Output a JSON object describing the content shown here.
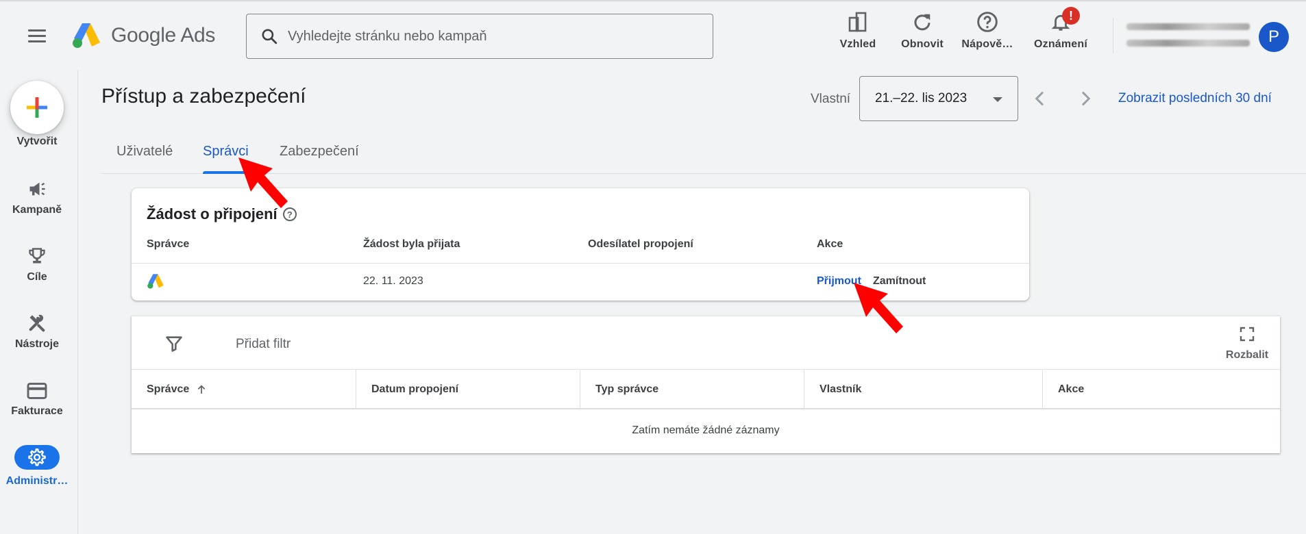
{
  "header": {
    "app_name": "Google Ads",
    "search_placeholder": "Vyhledejte stránku nebo kampaň",
    "tools": [
      {
        "label": "Vzhled",
        "icon": "appearance-icon"
      },
      {
        "label": "Obnovit",
        "icon": "refresh-icon"
      },
      {
        "label": "Nápově…",
        "icon": "help-icon"
      },
      {
        "label": "Oznámení",
        "icon": "bell-icon",
        "badge": "!"
      }
    ],
    "avatar_letter": "P"
  },
  "sidebar": {
    "items": [
      {
        "label": "Vytvořit",
        "icon": "plus-icon"
      },
      {
        "label": "Kampaně",
        "icon": "megaphone-icon"
      },
      {
        "label": "Cíle",
        "icon": "trophy-icon"
      },
      {
        "label": "Nástroje",
        "icon": "tools-icon"
      },
      {
        "label": "Fakturace",
        "icon": "credit-card-icon"
      },
      {
        "label": "Administr…",
        "icon": "gear-icon",
        "active": true
      }
    ]
  },
  "main": {
    "title": "Přístup a zabezpečení",
    "date_prefix": "Vlastní",
    "date_range": "21.–22. lis 2023",
    "last_30_link": "Zobrazit posledních 30 dní",
    "tabs": [
      {
        "label": "Uživatelé",
        "active": false
      },
      {
        "label": "Správci",
        "active": true
      },
      {
        "label": "Zabezpečení",
        "active": false
      }
    ]
  },
  "request_card": {
    "title": "Žádost o připojení",
    "columns": [
      "Správce",
      "Žádost byla přijata",
      "Odesílatel propojení",
      "Akce"
    ],
    "row": {
      "date": "22. 11. 2023",
      "accept": "Přijmout",
      "reject": "Zamítnout"
    }
  },
  "managers_table": {
    "add_filter": "Přidat filtr",
    "expand_label": "Rozbalit",
    "columns": [
      "Správce",
      "Datum propojení",
      "Typ správce",
      "Vlastník",
      "Akce"
    ],
    "empty_message": "Zatím nemáte žádné záznamy"
  },
  "colors": {
    "accent": "#1a73e8",
    "link": "#1a57c8",
    "alert": "#d93025",
    "pointer": "#ff0000"
  }
}
